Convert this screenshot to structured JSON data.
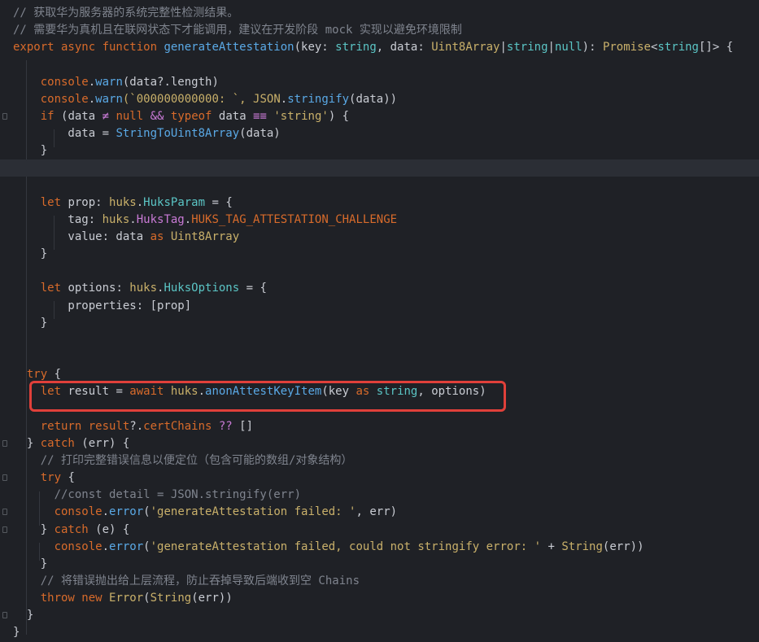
{
  "editor": {
    "lines": [
      [
        {
          "t": "// 获取华为服务器的系统完整性检测结果。",
          "c": "cm"
        }
      ],
      [
        {
          "t": "// 需要华为真机且在联网状态下才能调用，建议在开发阶段 mock 实现以避免环境限制",
          "c": "cm"
        }
      ],
      [
        {
          "t": "export async function ",
          "c": "kw"
        },
        {
          "t": "generateAttestation",
          "c": "fn"
        },
        {
          "t": "(key: ",
          "c": "pl"
        },
        {
          "t": "string",
          "c": "tyb"
        },
        {
          "t": ", data: ",
          "c": "pl"
        },
        {
          "t": "Uint8Array",
          "c": "ty"
        },
        {
          "t": "|",
          "c": "pl"
        },
        {
          "t": "string",
          "c": "tyb"
        },
        {
          "t": "|",
          "c": "pl"
        },
        {
          "t": "null",
          "c": "tyb"
        },
        {
          "t": "): ",
          "c": "pl"
        },
        {
          "t": "Promise",
          "c": "ty"
        },
        {
          "t": "<",
          "c": "pl"
        },
        {
          "t": "string",
          "c": "tyb"
        },
        {
          "t": "[]> {",
          "c": "pl"
        }
      ],
      [],
      [
        {
          "t": "    console",
          "c": "kw"
        },
        {
          "t": ".",
          "c": "pl"
        },
        {
          "t": "warn",
          "c": "fn"
        },
        {
          "t": "(data?.length)",
          "c": "pl"
        }
      ],
      [
        {
          "t": "    console",
          "c": "kw"
        },
        {
          "t": ".",
          "c": "pl"
        },
        {
          "t": "warn",
          "c": "fn"
        },
        {
          "t": "(`000000000000: `, ",
          "c": "str"
        },
        {
          "t": "JSON",
          "c": "ty"
        },
        {
          "t": ".",
          "c": "pl"
        },
        {
          "t": "stringify",
          "c": "fn"
        },
        {
          "t": "(data))",
          "c": "pl"
        }
      ],
      [
        {
          "t": "    if ",
          "c": "kw"
        },
        {
          "t": "(data ",
          "c": "pl"
        },
        {
          "t": "≠ ",
          "c": "op"
        },
        {
          "t": "null ",
          "c": "kw"
        },
        {
          "t": "&& ",
          "c": "op"
        },
        {
          "t": "typeof ",
          "c": "kw"
        },
        {
          "t": "data ",
          "c": "pl"
        },
        {
          "t": "≡≡ ",
          "c": "op"
        },
        {
          "t": "'string'",
          "c": "str"
        },
        {
          "t": ") {",
          "c": "pl"
        }
      ],
      [
        {
          "t": "        data = ",
          "c": "pl"
        },
        {
          "t": "StringToUint8Array",
          "c": "fn"
        },
        {
          "t": "(data)",
          "c": "pl"
        }
      ],
      [
        {
          "t": "    }",
          "c": "pl"
        }
      ],
      [],
      [],
      [
        {
          "t": "    let ",
          "c": "kw"
        },
        {
          "t": "prop: ",
          "c": "pl"
        },
        {
          "t": "huks",
          "c": "ty"
        },
        {
          "t": ".",
          "c": "pl"
        },
        {
          "t": "HuksParam ",
          "c": "tyb"
        },
        {
          "t": "= {",
          "c": "pl"
        }
      ],
      [
        {
          "t": "        tag: ",
          "c": "pl"
        },
        {
          "t": "huks",
          "c": "ty"
        },
        {
          "t": ".",
          "c": "pl"
        },
        {
          "t": "HuksTag",
          "c": "cls"
        },
        {
          "t": ".",
          "c": "pl"
        },
        {
          "t": "HUKS_TAG_ATTESTATION_CHALLENGE",
          "c": "con"
        }
      ],
      [
        {
          "t": "        value: data ",
          "c": "pl"
        },
        {
          "t": "as ",
          "c": "kw"
        },
        {
          "t": "Uint8Array",
          "c": "ty"
        }
      ],
      [
        {
          "t": "    }",
          "c": "pl"
        }
      ],
      [],
      [
        {
          "t": "    let ",
          "c": "kw"
        },
        {
          "t": "options: ",
          "c": "pl"
        },
        {
          "t": "huks",
          "c": "ty"
        },
        {
          "t": ".",
          "c": "pl"
        },
        {
          "t": "HuksOptions ",
          "c": "tyb"
        },
        {
          "t": "= {",
          "c": "pl"
        }
      ],
      [
        {
          "t": "        properties: [prop]",
          "c": "pl"
        }
      ],
      [
        {
          "t": "    }",
          "c": "pl"
        }
      ],
      [],
      [],
      [
        {
          "t": "  try ",
          "c": "kw"
        },
        {
          "t": "{",
          "c": "pl"
        }
      ],
      [
        {
          "t": "    let ",
          "c": "kw"
        },
        {
          "t": "result = ",
          "c": "pl"
        },
        {
          "t": "await ",
          "c": "kw"
        },
        {
          "t": "huks",
          "c": "ty"
        },
        {
          "t": ".",
          "c": "pl"
        },
        {
          "t": "anonAttestKeyItem",
          "c": "fn"
        },
        {
          "t": "(key ",
          "c": "pl"
        },
        {
          "t": "as ",
          "c": "kw"
        },
        {
          "t": "string",
          "c": "tyb"
        },
        {
          "t": ", options)",
          "c": "pl"
        }
      ],
      [],
      [
        {
          "t": "    return ",
          "c": "kw"
        },
        {
          "t": "result",
          "c": "kw"
        },
        {
          "t": "?.",
          "c": "pl"
        },
        {
          "t": "certChains ",
          "c": "kw"
        },
        {
          "t": "?? ",
          "c": "op"
        },
        {
          "t": "[]",
          "c": "pl"
        }
      ],
      [
        {
          "t": "  } ",
          "c": "pl"
        },
        {
          "t": "catch ",
          "c": "kw"
        },
        {
          "t": "(err) {",
          "c": "pl"
        }
      ],
      [
        {
          "t": "    // 打印完整错误信息以便定位（包含可能的数组/对象结构）",
          "c": "cm"
        }
      ],
      [
        {
          "t": "    try ",
          "c": "kw"
        },
        {
          "t": "{",
          "c": "pl"
        }
      ],
      [
        {
          "t": "      //const detail = JSON.stringify(err)",
          "c": "cm"
        }
      ],
      [
        {
          "t": "      console",
          "c": "kw"
        },
        {
          "t": ".",
          "c": "pl"
        },
        {
          "t": "error",
          "c": "fn"
        },
        {
          "t": "(",
          "c": "pl"
        },
        {
          "t": "'generateAttestation failed: '",
          "c": "str"
        },
        {
          "t": ", err)",
          "c": "pl"
        }
      ],
      [
        {
          "t": "    } ",
          "c": "pl"
        },
        {
          "t": "catch ",
          "c": "kw"
        },
        {
          "t": "(e) {",
          "c": "pl"
        }
      ],
      [
        {
          "t": "      console",
          "c": "kw"
        },
        {
          "t": ".",
          "c": "pl"
        },
        {
          "t": "error",
          "c": "fn"
        },
        {
          "t": "(",
          "c": "pl"
        },
        {
          "t": "'generateAttestation failed, could not stringify error: '",
          "c": "str"
        },
        {
          "t": " + ",
          "c": "pl"
        },
        {
          "t": "String",
          "c": "ty"
        },
        {
          "t": "(err))",
          "c": "pl"
        }
      ],
      [
        {
          "t": "    }",
          "c": "pl"
        }
      ],
      [
        {
          "t": "    // 将错误抛出给上层流程，防止吞掉导致后端收到空 Chains",
          "c": "cm"
        }
      ],
      [
        {
          "t": "    throw ",
          "c": "kw"
        },
        {
          "t": "new ",
          "c": "kw"
        },
        {
          "t": "Error",
          "c": "ty"
        },
        {
          "t": "(",
          "c": "pl"
        },
        {
          "t": "String",
          "c": "ty"
        },
        {
          "t": "(err))",
          "c": "pl"
        }
      ],
      [
        {
          "t": "  }",
          "c": "pl"
        }
      ],
      [
        {
          "t": "}",
          "c": "pl"
        }
      ]
    ],
    "current_line": 9,
    "highlighted_line": 22,
    "colors": {
      "background": "#1f2126",
      "highlight": "#e0403a"
    }
  }
}
